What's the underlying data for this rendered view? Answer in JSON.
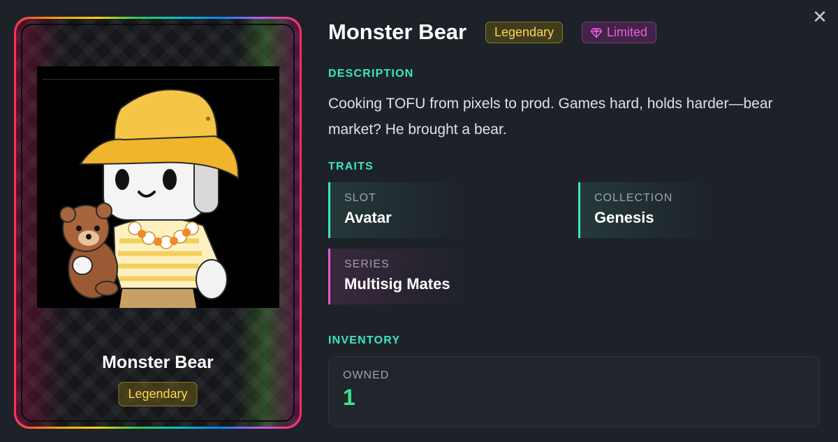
{
  "item": {
    "name": "Monster Bear",
    "rarity": "Legendary",
    "edition": "Limited",
    "description": "Cooking TOFU from pixels to prod. Games hard, holds harder—bear market? He brought a bear."
  },
  "sections": {
    "description_label": "DESCRIPTION",
    "traits_label": "TRAITS",
    "inventory_label": "INVENTORY"
  },
  "traits": [
    {
      "key": "SLOT",
      "value": "Avatar"
    },
    {
      "key": "COLLECTION",
      "value": "Genesis"
    },
    {
      "key": "SERIES",
      "value": "Multisig Mates"
    }
  ],
  "inventory": {
    "owned_label": "OWNED",
    "owned_value": "1"
  },
  "close": {
    "label": "✕"
  },
  "colors": {
    "accent_teal": "#3ce5c4",
    "legendary_gold": "#ffd84d",
    "limited_pink": "#f05cd8",
    "owned_green": "#3ce58f"
  },
  "icons": {
    "close": "close-icon",
    "gem": "gem-icon"
  }
}
